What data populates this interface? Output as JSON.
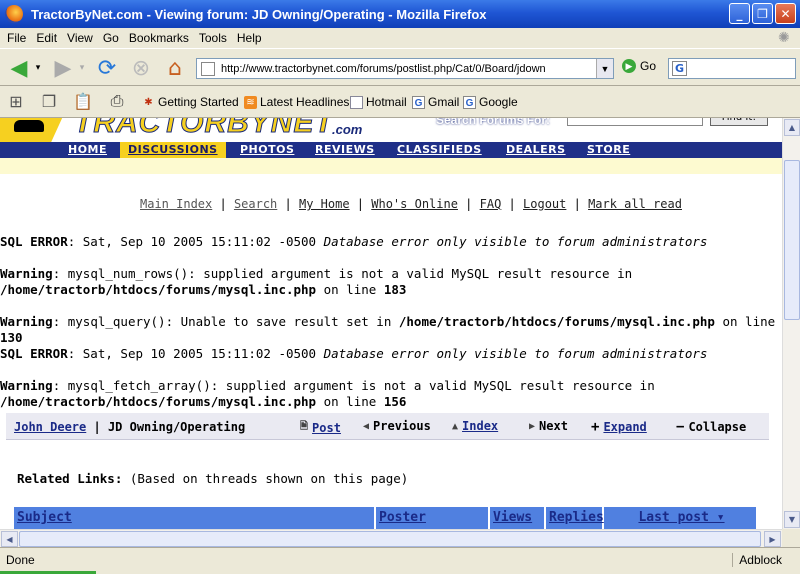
{
  "window": {
    "title": "TractorByNet.com - Viewing forum: JD Owning/Operating - Mozilla Firefox",
    "minimize_glyph": "_",
    "maximize_glyph": "❐",
    "close_glyph": "✕"
  },
  "menu": [
    "File",
    "Edit",
    "View",
    "Go",
    "Bookmarks",
    "Tools",
    "Help"
  ],
  "navbar": {
    "url": "http://www.tractorbynet.com/forums/postlist.php/Cat/0/Board/jdown",
    "go_label": "Go",
    "search_engine_glyph": "G"
  },
  "bookmarks": [
    {
      "label": "Getting Started",
      "icon": "ant-icon"
    },
    {
      "label": "Latest Headlines",
      "icon": "rss-icon"
    },
    {
      "label": "Hotmail",
      "icon": "page-icon"
    },
    {
      "label": "Gmail",
      "icon": "google-icon"
    },
    {
      "label": "Google",
      "icon": "google-icon"
    }
  ],
  "site": {
    "logo_text": "TRACTORBYNET",
    "logo_suffix": ".com",
    "search_label": "Search Forums For:",
    "find_button": "Find It!",
    "tabs": [
      "HOME",
      "DISCUSSIONS",
      "PHOTOS",
      "REVIEWS",
      "CLASSIFIEDS",
      "DEALERS",
      "STORE"
    ],
    "active_tab": "DISCUSSIONS"
  },
  "toplinks": [
    "Main Index",
    "Search",
    "My Home",
    "Who's Online",
    "FAQ",
    "Logout",
    "Mark all read"
  ],
  "errors": {
    "sql1_label": "SQL ERROR",
    "sql1_time": ": Sat, Sep 10 2005 15:11:02 -0500 ",
    "sql1_msg": "Database error only visible to forum administrators",
    "warn1_label": "Warning",
    "warn1_text": ": mysql_num_rows(): supplied argument is not a valid MySQL result resource in",
    "warn1_path": "/home/tractorb/htdocs/forums/mysql.inc.php",
    "warn1_online": " on line ",
    "warn1_line": "183",
    "warn2_label": "Warning",
    "warn2_text": ": mysql_query(): Unable to save result set in ",
    "warn2_path": "/home/tractorb/htdocs/forums/mysql.inc.php",
    "warn2_online": " on line",
    "warn2_line": "130",
    "sql2_label": "SQL ERROR",
    "sql2_time": ": Sat, Sep 10 2005 15:11:02 -0500 ",
    "sql2_msg": "Database error only visible to forum administrators",
    "warn3_label": "Warning",
    "warn3_text": ": mysql_fetch_array(): supplied argument is not a valid MySQL result resource in",
    "warn3_path": "/home/tractorb/htdocs/forums/mysql.inc.php",
    "warn3_online": " on line ",
    "warn3_line": "156"
  },
  "forumnav": {
    "category": "John Deere",
    "separator": " | ",
    "forum": "JD Owning/Operating",
    "post": "Post",
    "previous": "Previous",
    "index": "Index",
    "next": "Next",
    "expand": "Expand",
    "collapse": "Collapse"
  },
  "related": {
    "label": "Related Links:",
    "note": " (Based on threads shown on this page)"
  },
  "table_headers": [
    "Subject",
    "Poster",
    "Views",
    "Replies",
    "Last post ▾"
  ],
  "status": {
    "text": "Done",
    "adblock": "Adblock"
  }
}
